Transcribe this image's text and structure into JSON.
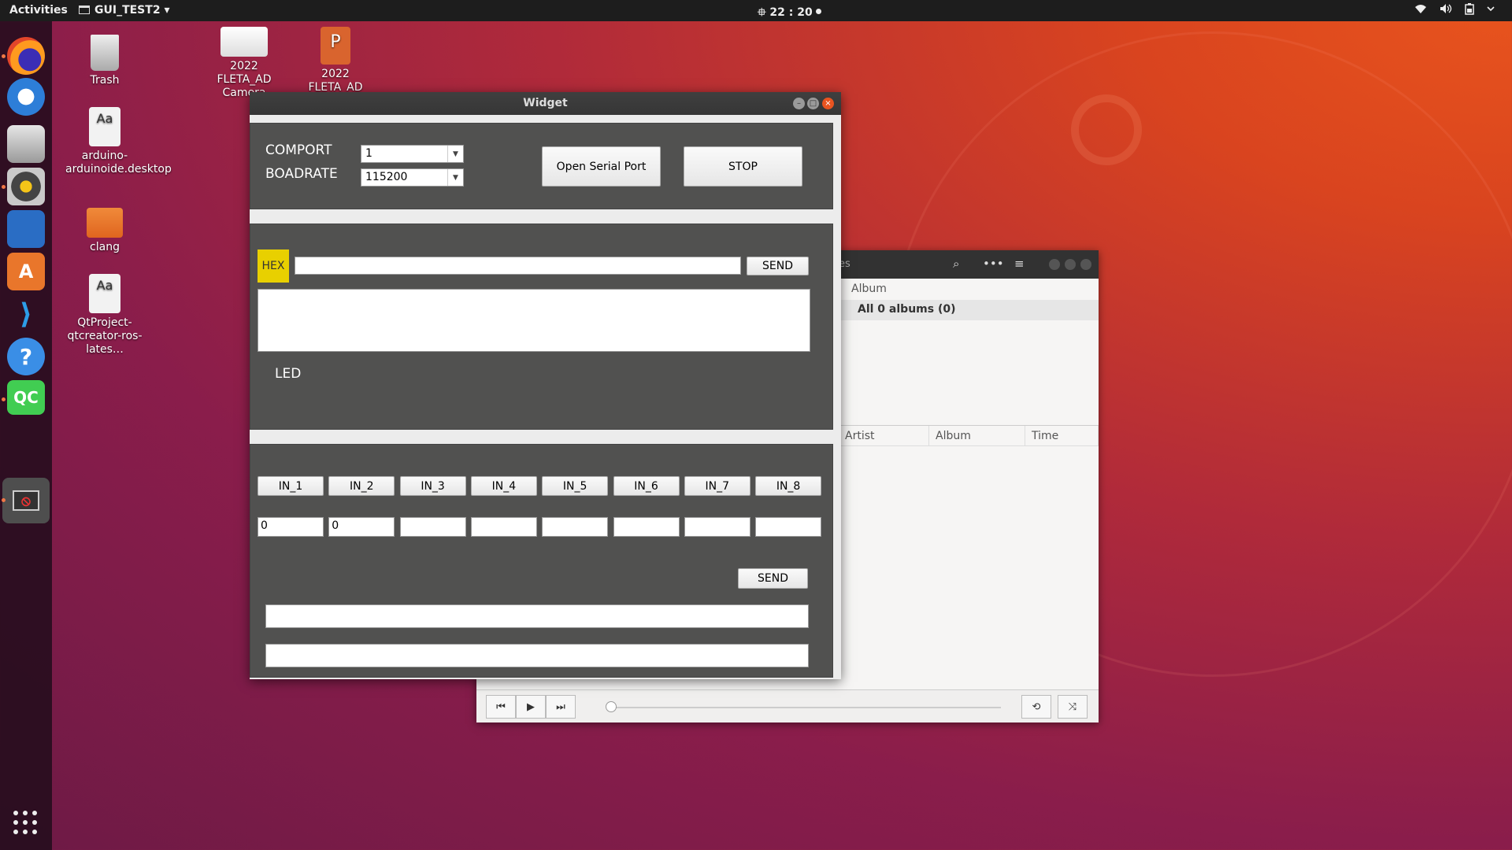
{
  "topbar": {
    "activities": "Activities",
    "app_name": "GUI_TEST2",
    "app_caret": "▾",
    "clock": "22 : 20",
    "clock_prefix": "⯐"
  },
  "desktop": {
    "icons": [
      {
        "label": "Trash"
      },
      {
        "label": "arduino-arduinoide.desktop"
      },
      {
        "label": "clang"
      },
      {
        "label": "QtProject-qtcreator-ros-lates…"
      },
      {
        "label": "2022 FLETA_AD Camera"
      },
      {
        "label": "2022 FLETA_AD"
      }
    ]
  },
  "music": {
    "title_fragment": "es",
    "album_col": "Album",
    "albums_row": "All 0 albums (0)",
    "list_cols": [
      "Artist",
      "Album",
      "Time"
    ]
  },
  "widget": {
    "title": "Widget",
    "comport_label": "COMPORT",
    "comport_value": "1",
    "boadrate_label": "BOADRATE",
    "boadrate_value": "115200",
    "open_button": "Open Serial Port",
    "stop_button": "STOP",
    "hex_label": "HEX",
    "hex_input": "",
    "send_label": "SEND",
    "led_label": "LED",
    "led_color": "#cc0000",
    "led_count": 8,
    "inputs": [
      {
        "label": "IN_1",
        "value": "0"
      },
      {
        "label": "IN_2",
        "value": "0"
      },
      {
        "label": "IN_3",
        "value": ""
      },
      {
        "label": "IN_4",
        "value": ""
      },
      {
        "label": "IN_5",
        "value": ""
      },
      {
        "label": "IN_6",
        "value": ""
      },
      {
        "label": "IN_7",
        "value": ""
      },
      {
        "label": "IN_8",
        "value": ""
      }
    ],
    "send2_label": "SEND"
  }
}
